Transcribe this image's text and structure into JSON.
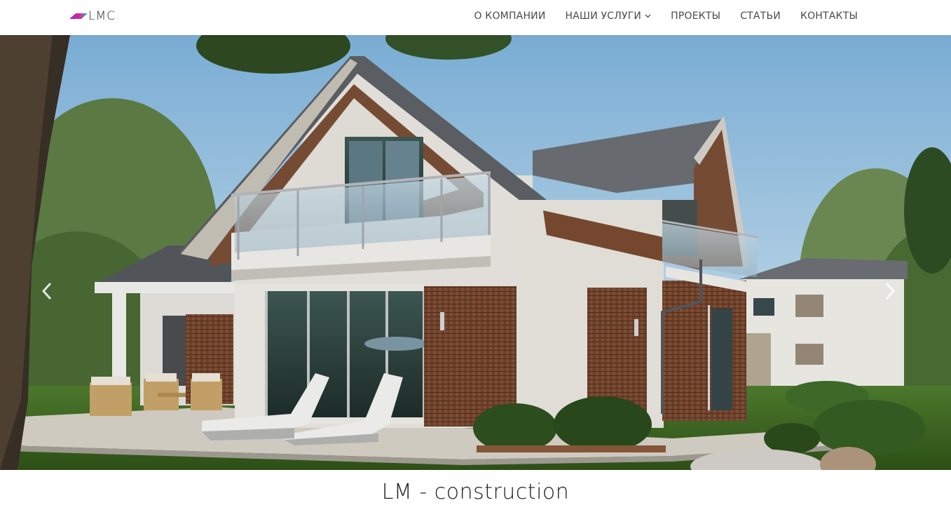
{
  "brand": {
    "name": "LMC",
    "logo_colors": [
      "#8e2de2",
      "#2bb6e5"
    ]
  },
  "nav": {
    "items": [
      {
        "label": "О КОМПАНИИ"
      },
      {
        "label": "НАШИ УСЛУГИ",
        "icon": "chevron-down-icon"
      },
      {
        "label": "ПРОЕКТЫ"
      },
      {
        "label": "СТАТЬИ"
      },
      {
        "label": "КОНТАКТЫ"
      }
    ]
  },
  "hero": {
    "prev_icon": "chevron-left-icon",
    "next_icon": "chevron-right-icon"
  },
  "main": {
    "title": "LM - construction"
  },
  "colors": {
    "sky": "#a9cfe9",
    "roof": "#5e6166",
    "wall": "#eceae4",
    "wood": "#7a4a33",
    "grass": "#3e6a26"
  }
}
